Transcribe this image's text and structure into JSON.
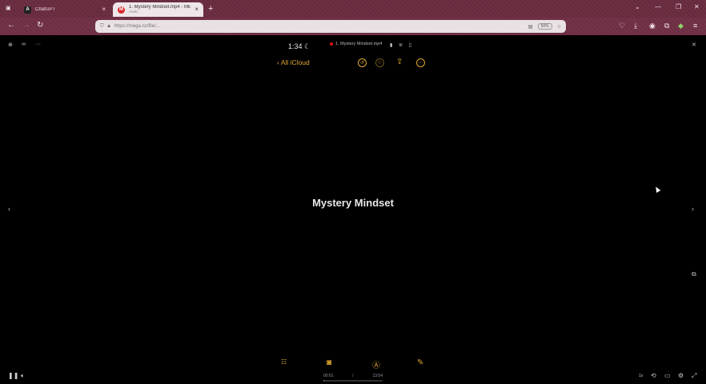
{
  "browser": {
    "tabs": [
      {
        "title": "ChatGPT",
        "subtitle": "",
        "favicon": "A",
        "active": false
      },
      {
        "title": "1. Mystery Mindset.mp4 - MEGA",
        "subtitle": "Audio",
        "favicon": "M",
        "active": true
      }
    ],
    "url": "https://mega.nz/file/...",
    "zoom": "50%"
  },
  "viewer": {
    "status_time": "1:34",
    "file_title": "1. Mystery Mindset.mp4",
    "back_label": "All iCloud",
    "note_title": "Mystery Mindset",
    "current_time": "00:01",
    "separator": "/",
    "duration": "13:54",
    "speed": "1x",
    "progress": 0.02
  },
  "colors": {
    "accent": "#e0a732",
    "tab_bar": "#6a2c40",
    "progress": "#6aa64c"
  }
}
